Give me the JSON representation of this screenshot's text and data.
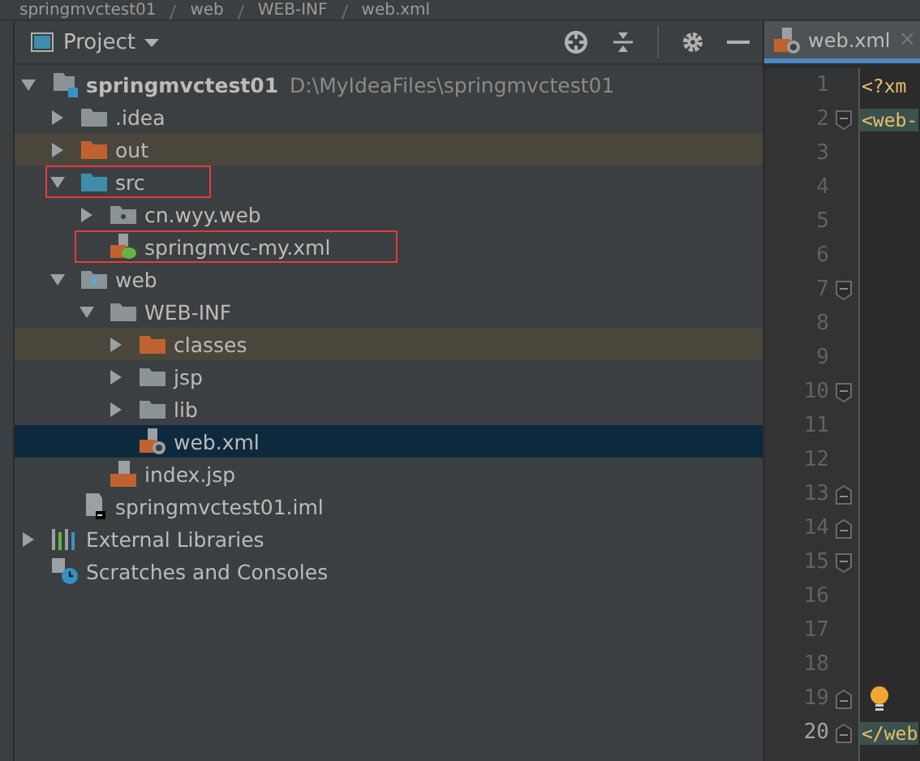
{
  "breadcrumb": [
    "springmvctest01",
    "web",
    "WEB-INF",
    "web.xml"
  ],
  "project_panel": {
    "title": "Project"
  },
  "tree": [
    {
      "label": "springmvctest01",
      "path": "D:\\MyIdeaFiles\\springmvctest01",
      "kind": "module",
      "expanded": true,
      "selected": false,
      "excluded": false,
      "annotated": false,
      "children": [
        {
          "label": ".idea",
          "kind": "folder",
          "expanded": false,
          "selected": false,
          "excluded": false,
          "annotated": false
        },
        {
          "label": "out",
          "kind": "folder",
          "expanded": false,
          "selected": false,
          "excluded": true,
          "annotated": false
        },
        {
          "label": "src",
          "kind": "source",
          "expanded": true,
          "selected": false,
          "excluded": false,
          "annotated": true,
          "children": [
            {
              "label": "cn.wyy.web",
              "kind": "package",
              "expanded": false,
              "selected": false,
              "excluded": false,
              "annotated": false
            },
            {
              "label": "springmvc-my.xml",
              "kind": "springxml",
              "selected": false,
              "excluded": false,
              "annotated": true
            }
          ]
        },
        {
          "label": "web",
          "kind": "webroot",
          "expanded": true,
          "selected": false,
          "excluded": false,
          "annotated": false,
          "children": [
            {
              "label": "WEB-INF",
              "kind": "folder",
              "expanded": true,
              "selected": false,
              "excluded": false,
              "annotated": false,
              "children": [
                {
                  "label": "classes",
                  "kind": "folder",
                  "expanded": false,
                  "selected": false,
                  "excluded": true,
                  "annotated": false
                },
                {
                  "label": "jsp",
                  "kind": "folder",
                  "expanded": false,
                  "selected": false,
                  "excluded": false,
                  "annotated": false
                },
                {
                  "label": "lib",
                  "kind": "folder",
                  "expanded": false,
                  "selected": false,
                  "excluded": false,
                  "annotated": false
                },
                {
                  "label": "web.xml",
                  "kind": "webxml",
                  "selected": true,
                  "excluded": false,
                  "annotated": false
                }
              ]
            },
            {
              "label": "index.jsp",
              "kind": "jsp",
              "selected": false,
              "excluded": false,
              "annotated": false
            }
          ]
        },
        {
          "label": "springmvctest01.iml",
          "kind": "iml",
          "selected": false,
          "excluded": false,
          "annotated": false
        }
      ]
    },
    {
      "label": "External Libraries",
      "kind": "libraries",
      "expanded": false,
      "selected": false,
      "excluded": false,
      "annotated": false
    },
    {
      "label": "Scratches and Consoles",
      "kind": "scratches",
      "selected": false,
      "excluded": false,
      "annotated": false
    }
  ],
  "editor": {
    "tab": {
      "label": "web.xml",
      "close": "×",
      "selected": true
    },
    "lines": [
      {
        "number": "1",
        "code": "<?xm",
        "kind": "plain",
        "current": false,
        "tag_highlight": false,
        "bulb": false
      },
      {
        "number": "2",
        "code": "<web-",
        "kind": "foldstart",
        "current": false,
        "tag_highlight": true,
        "bulb": false
      },
      {
        "number": "3",
        "kind": "plain",
        "current": false,
        "bulb": false
      },
      {
        "number": "4",
        "kind": "plain",
        "current": false,
        "bulb": false
      },
      {
        "number": "5",
        "kind": "plain",
        "current": false,
        "bulb": false
      },
      {
        "number": "6",
        "kind": "plain",
        "current": false,
        "bulb": false
      },
      {
        "number": "7",
        "kind": "foldstart",
        "current": false,
        "bulb": false
      },
      {
        "number": "8",
        "kind": "plain",
        "current": false,
        "bulb": false
      },
      {
        "number": "9",
        "kind": "plain",
        "current": false,
        "bulb": false
      },
      {
        "number": "10",
        "kind": "foldstart",
        "current": false,
        "bulb": false
      },
      {
        "number": "11",
        "kind": "plain",
        "current": false,
        "bulb": false
      },
      {
        "number": "12",
        "kind": "plain",
        "current": false,
        "bulb": false
      },
      {
        "number": "13",
        "kind": "foldend",
        "current": false,
        "bulb": false
      },
      {
        "number": "14",
        "kind": "foldend",
        "current": false,
        "bulb": false
      },
      {
        "number": "15",
        "kind": "foldstart",
        "current": false,
        "bulb": false
      },
      {
        "number": "16",
        "kind": "plain",
        "current": false,
        "bulb": false
      },
      {
        "number": "17",
        "kind": "plain",
        "current": false,
        "bulb": false
      },
      {
        "number": "18",
        "kind": "plain",
        "current": false,
        "bulb": false
      },
      {
        "number": "19",
        "kind": "foldend",
        "current": false,
        "bulb": true
      },
      {
        "number": "20",
        "code": "</web",
        "kind": "foldend",
        "current": true,
        "tag_highlight": true,
        "bulb": false
      }
    ]
  }
}
